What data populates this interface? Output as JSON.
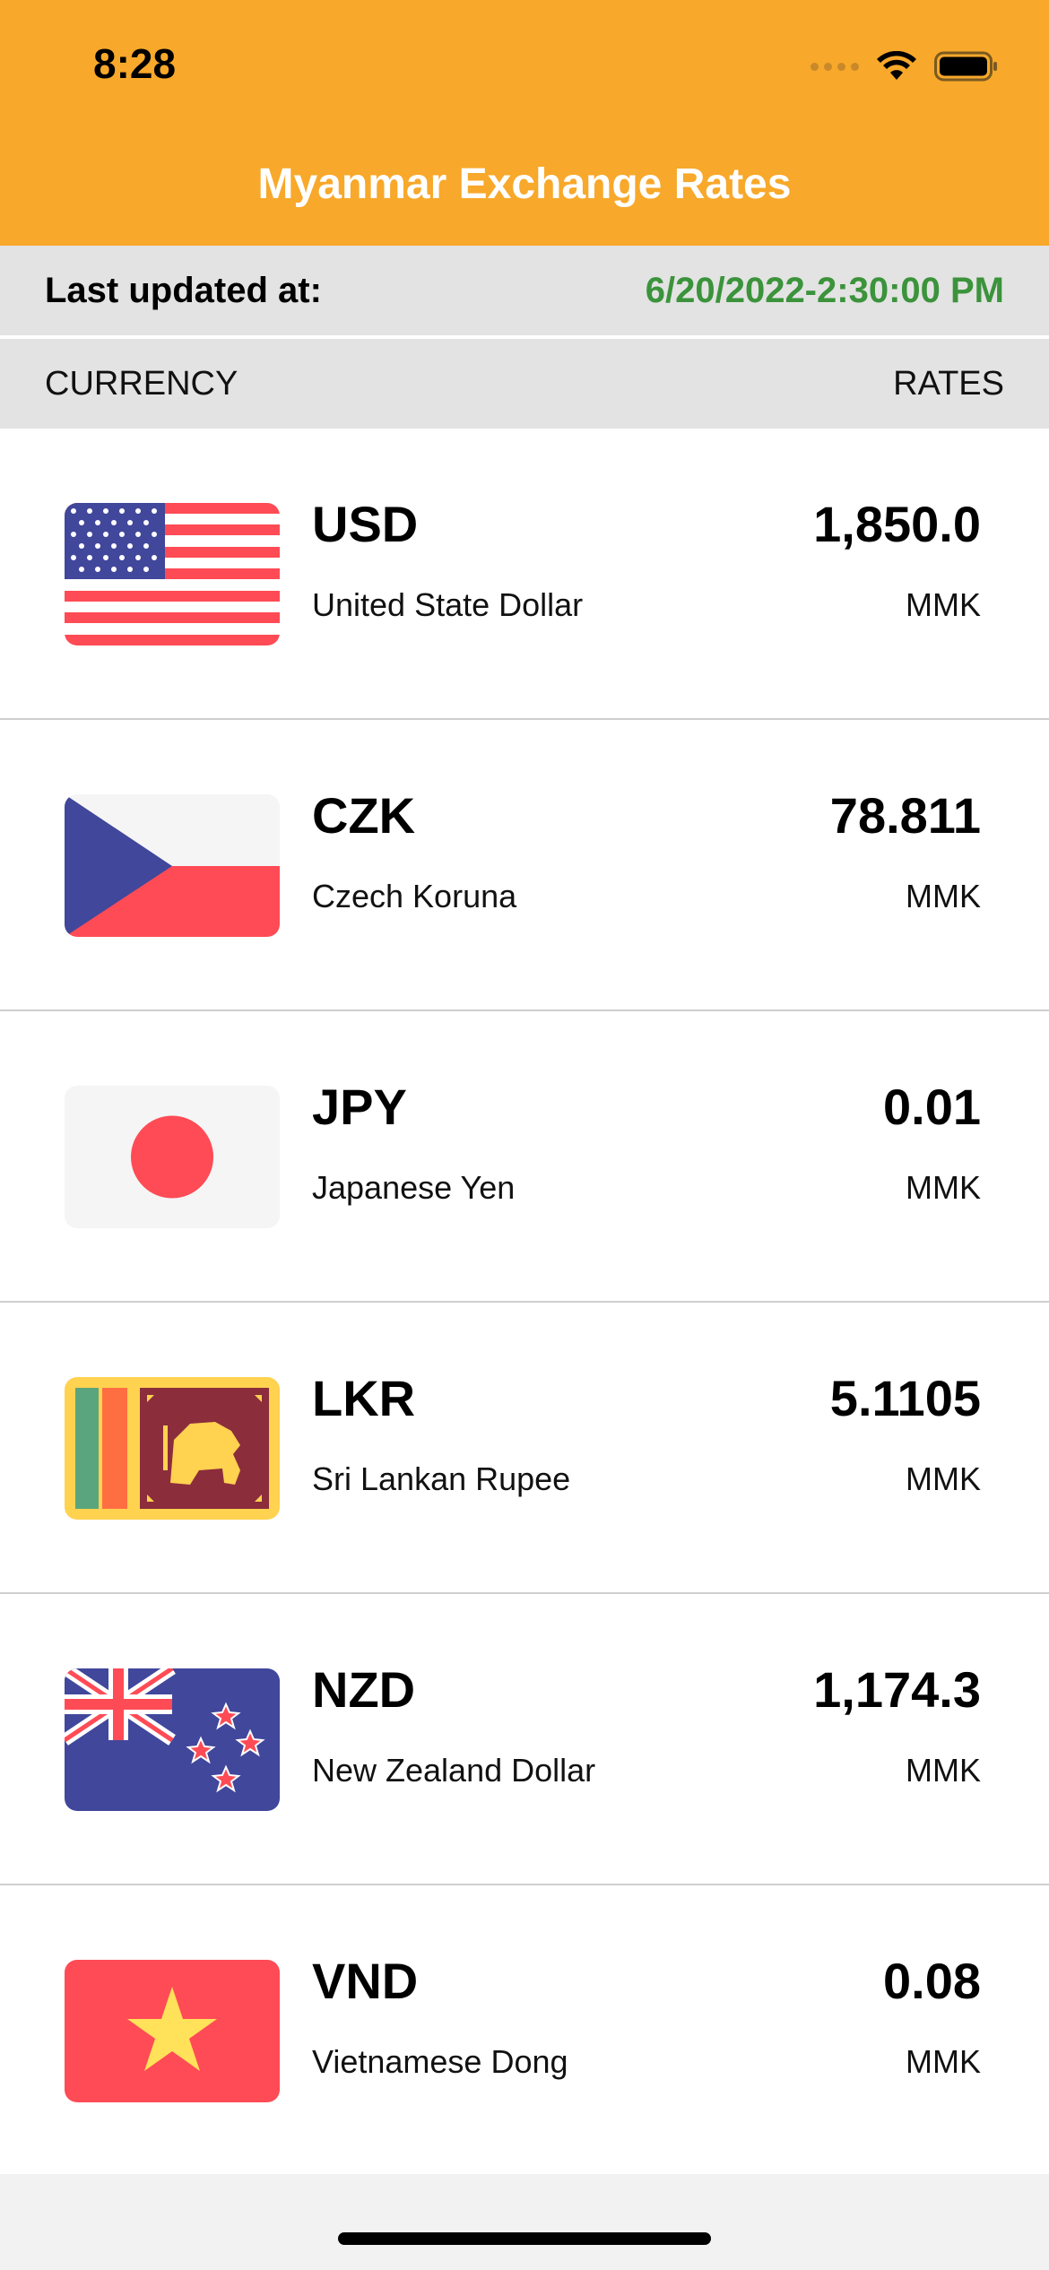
{
  "status_bar": {
    "time": "8:28"
  },
  "header": {
    "title": "Myanmar Exchange Rates"
  },
  "updated": {
    "label": "Last updated at:",
    "value": "6/20/2022-2:30:00 PM"
  },
  "columns": {
    "currency": "CURRENCY",
    "rates": "RATES"
  },
  "rows": [
    {
      "code": "USD",
      "name": "United State Dollar",
      "rate": "1,850.0",
      "unit": "MMK",
      "flag_icon": "us-flag-icon"
    },
    {
      "code": "CZK",
      "name": "Czech Koruna",
      "rate": "78.811",
      "unit": "MMK",
      "flag_icon": "czech-flag-icon"
    },
    {
      "code": "JPY",
      "name": "Japanese Yen",
      "rate": "0.01",
      "unit": "MMK",
      "flag_icon": "japan-flag-icon"
    },
    {
      "code": "LKR",
      "name": "Sri Lankan Rupee",
      "rate": "5.1105",
      "unit": "MMK",
      "flag_icon": "sri-lanka-flag-icon"
    },
    {
      "code": "NZD",
      "name": "New Zealand Dollar",
      "rate": "1,174.3",
      "unit": "MMK",
      "flag_icon": "new-zealand-flag-icon"
    },
    {
      "code": "VND",
      "name": "Vietnamese Dong",
      "rate": "0.08",
      "unit": "MMK",
      "flag_icon": "vietnam-flag-icon"
    }
  ],
  "colors": {
    "header_bg": "#f8a82a",
    "updated_value": "#3b933b",
    "bar_bg": "#e3e3e3"
  }
}
